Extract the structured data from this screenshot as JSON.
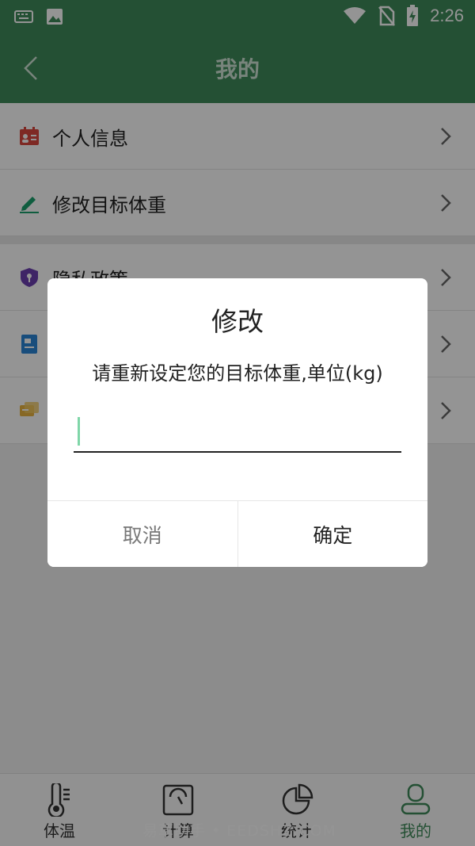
{
  "status_bar": {
    "time": "2:26",
    "icons": [
      "keyboard-icon",
      "image-icon",
      "wifi-icon",
      "no-sim-icon",
      "battery-charging-icon"
    ]
  },
  "app_bar": {
    "title": "我的"
  },
  "menu": {
    "group1": [
      {
        "label": "个人信息",
        "icon": "id-card-icon",
        "color": "#d9473f"
      },
      {
        "label": "修改目标体重",
        "icon": "pencil-icon",
        "color": "#1aa06d"
      }
    ],
    "group2": [
      {
        "label": "隐私政策",
        "icon": "shield-lock-icon",
        "color": "#6b3fb0"
      },
      {
        "label": "",
        "icon": "document-icon",
        "color": "#2a86d6"
      },
      {
        "label": "",
        "icon": "chat-icon",
        "color": "#e8b340"
      }
    ]
  },
  "tabbar": {
    "items": [
      {
        "label": "体温",
        "icon": "thermometer-icon"
      },
      {
        "label": "计算",
        "icon": "scale-icon"
      },
      {
        "label": "统计",
        "icon": "pie-chart-icon"
      },
      {
        "label": "我的",
        "icon": "profile-icon",
        "active": true
      }
    ]
  },
  "watermark": "易草助手 • EEDSHZ.COM",
  "dialog": {
    "title": "修改",
    "message": "请重新设定您的目标体重,单位(kg)",
    "input_value": "",
    "cancel_label": "取消",
    "confirm_label": "确定"
  },
  "colors": {
    "primary": "#3f8a5a",
    "accent_caret": "#7fd6a8"
  }
}
